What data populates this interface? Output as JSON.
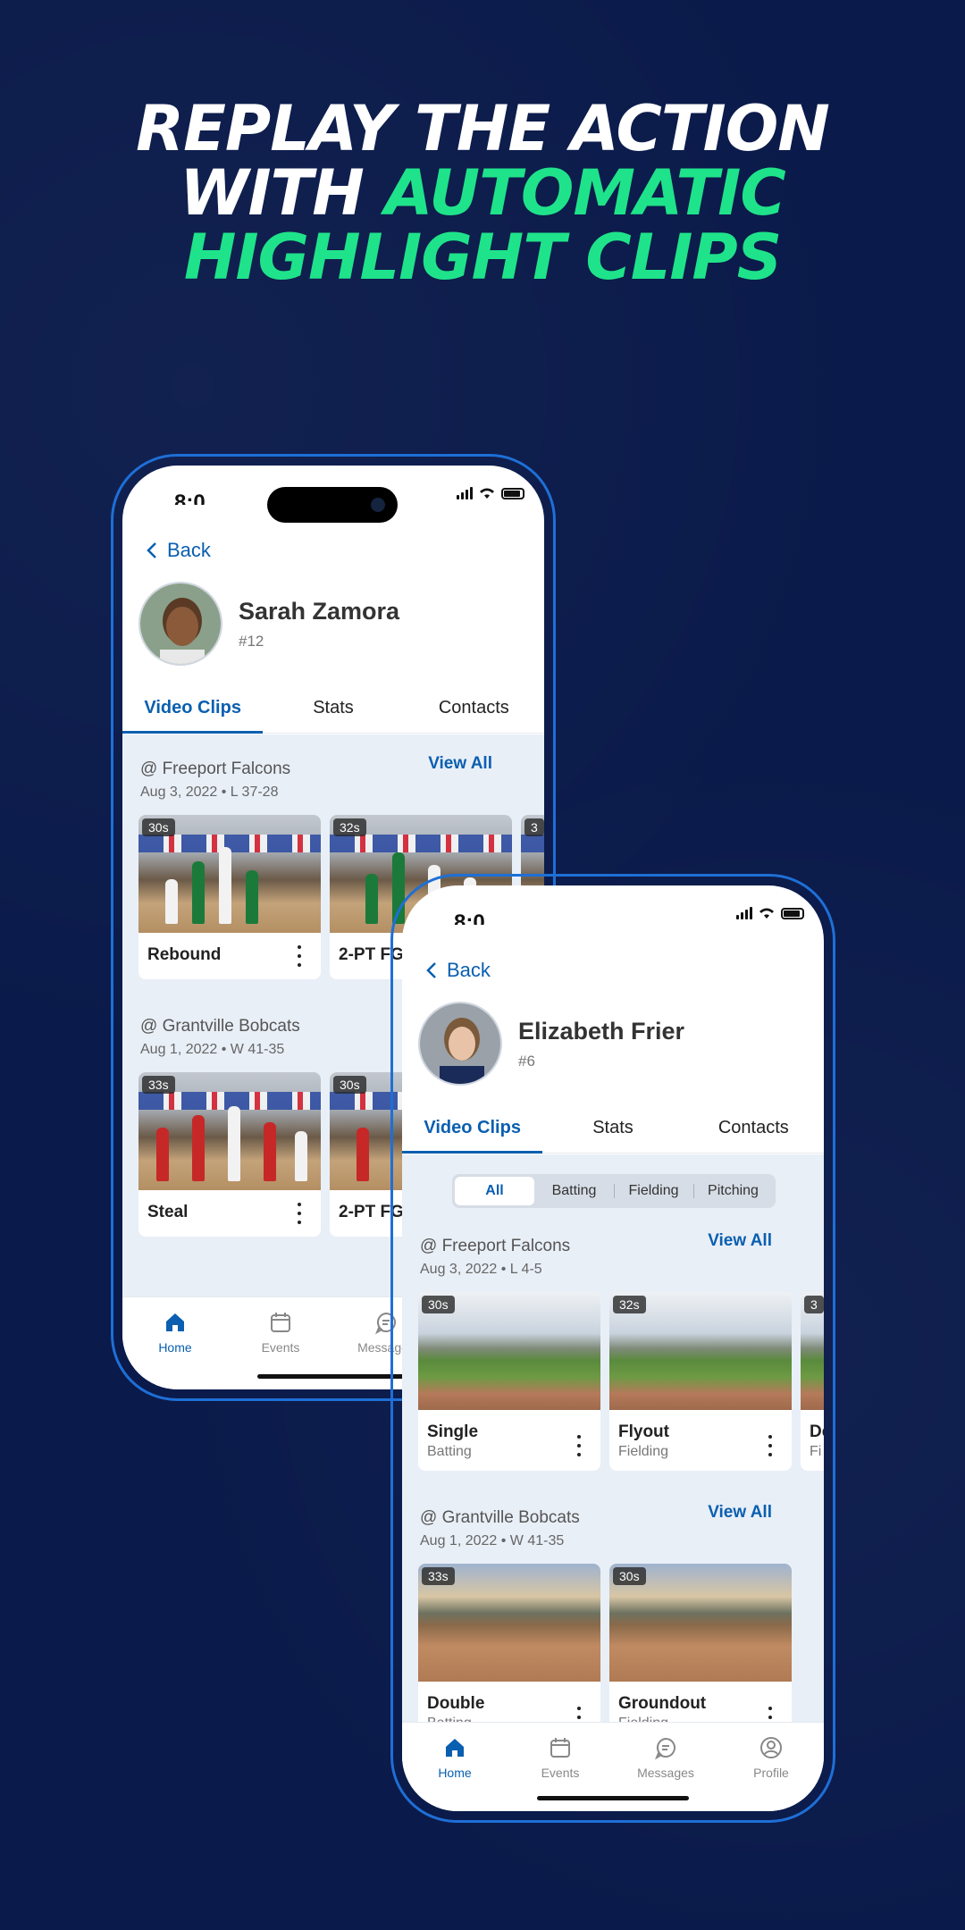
{
  "headline": {
    "line1": "REPLAY THE ACTION",
    "line2_white": "WITH ",
    "line2_green": "AUTOMATIC",
    "line3": "HIGHLIGHT CLIPS"
  },
  "colors": {
    "background": "#0a1a4a",
    "accent_green": "#1fe38a",
    "brand_blue": "#0a5fb0",
    "frame_blue": "#1e6fd6"
  },
  "phone1": {
    "status_time": "8:0",
    "back_label": "Back",
    "player": {
      "name": "Sarah Zamora",
      "number": "#12"
    },
    "tabs": [
      "Video Clips",
      "Stats",
      "Contacts"
    ],
    "active_tab": "Video Clips",
    "sections": [
      {
        "title": "@ Freeport Falcons",
        "subtitle": "Aug 3, 2022 • L 37-28",
        "view_all": "View All",
        "clips": [
          {
            "duration": "30s",
            "label": "Rebound"
          },
          {
            "duration": "32s",
            "label": "2-PT FG"
          },
          {
            "duration": "3",
            "label": ""
          }
        ]
      },
      {
        "title": "@ Grantville Bobcats",
        "subtitle": "Aug 1, 2022 • W 41-35",
        "clips": [
          {
            "duration": "33s",
            "label": "Steal"
          },
          {
            "duration": "30s",
            "label": "2-PT FG"
          }
        ]
      }
    ],
    "nav": [
      {
        "label": "Home",
        "icon": "home-icon"
      },
      {
        "label": "Events",
        "icon": "calendar-icon"
      },
      {
        "label": "Messages",
        "icon": "message-icon"
      }
    ]
  },
  "phone2": {
    "status_time": "8:0",
    "back_label": "Back",
    "player": {
      "name": "Elizabeth Frier",
      "number": "#6"
    },
    "tabs": [
      "Video Clips",
      "Stats",
      "Contacts"
    ],
    "active_tab": "Video Clips",
    "filters": [
      "All",
      "Batting",
      "Fielding",
      "Pitching"
    ],
    "active_filter": "All",
    "sections": [
      {
        "title": "@ Freeport Falcons",
        "subtitle": "Aug 3, 2022 • L 4-5",
        "view_all": "View All",
        "clips": [
          {
            "duration": "30s",
            "label": "Single",
            "category": "Batting"
          },
          {
            "duration": "32s",
            "label": "Flyout",
            "category": "Fielding"
          },
          {
            "duration": "3",
            "label": "De",
            "category": "Fi"
          }
        ]
      },
      {
        "title": "@ Grantville Bobcats",
        "subtitle": "Aug 1, 2022 • W 41-35",
        "view_all": "View All",
        "clips": [
          {
            "duration": "33s",
            "label": "Double",
            "category": "Batting"
          },
          {
            "duration": "30s",
            "label": "Groundout",
            "category": "Fielding"
          }
        ]
      }
    ],
    "nav": [
      {
        "label": "Home",
        "icon": "home-icon"
      },
      {
        "label": "Events",
        "icon": "calendar-icon"
      },
      {
        "label": "Messages",
        "icon": "message-icon"
      },
      {
        "label": "Profile",
        "icon": "profile-icon"
      }
    ]
  }
}
